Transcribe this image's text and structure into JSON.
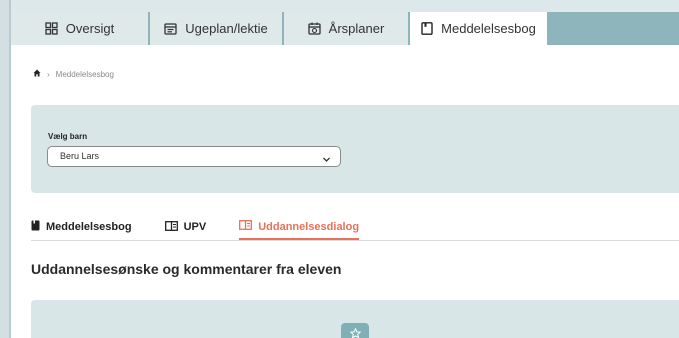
{
  "tabs": [
    {
      "label": "Oversigt",
      "icon": "grid-icon"
    },
    {
      "label": "Ugeplan/lektie",
      "icon": "calendar-icon"
    },
    {
      "label": "Årsplaner",
      "icon": "calendar-check-icon"
    },
    {
      "label": "Meddelelsesbog",
      "icon": "notebook-icon",
      "active": true
    }
  ],
  "breadcrumb": {
    "home_icon": "home-icon",
    "current": "Meddelelsesbog"
  },
  "child_select": {
    "label": "Vælg barn",
    "value": "Beru Lars"
  },
  "subtabs": [
    {
      "label": "Meddelelsesbog",
      "icon": "book-icon"
    },
    {
      "label": "UPV",
      "icon": "book-open-icon"
    },
    {
      "label": "Uddannelsesdialog",
      "icon": "book-open-icon",
      "active": true
    }
  ],
  "section_title": "Uddannelsesønske og kommentarer fra eleven",
  "colors": {
    "accent": "#e8705a",
    "teal": "#8eb5bb",
    "panel": "#d9e6e7"
  }
}
